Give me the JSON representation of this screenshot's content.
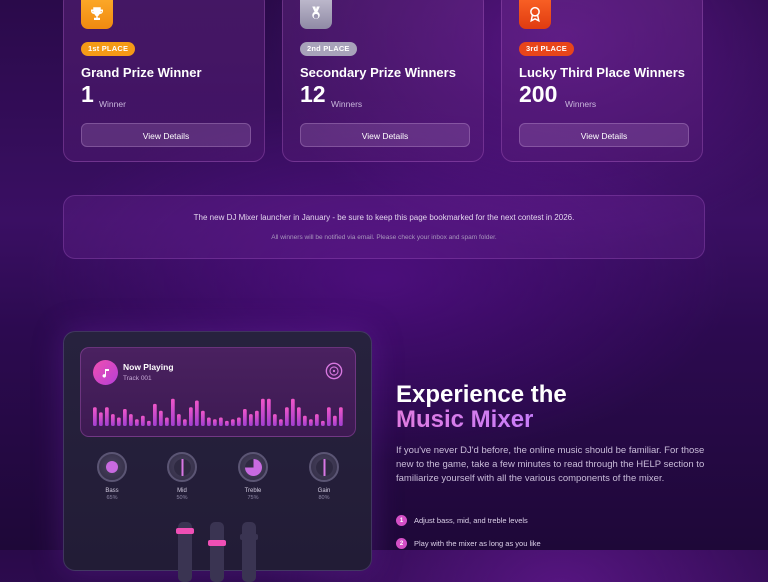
{
  "prize_cards": [
    {
      "badge": "1st PLACE",
      "title": "Grand Prize Winner",
      "count": "1",
      "unit": "Winner",
      "button": "View Details",
      "icon": "trophy-icon",
      "color": "#f59a16"
    },
    {
      "badge": "2nd PLACE",
      "title": "Secondary Prize Winners",
      "count": "12",
      "unit": "Winners",
      "button": "View Details",
      "icon": "medal-icon",
      "color": "#a8a3ba"
    },
    {
      "badge": "3rd PLACE",
      "title": "Lucky Third Place Winners",
      "count": "200",
      "unit": "Winners",
      "button": "View Details",
      "icon": "ribbon-award-icon",
      "color": "#e8451a"
    }
  ],
  "notice": {
    "main": "The new DJ Mixer launcher in January - be sure to keep this page bookmarked for the next contest in 2026.",
    "sub": "All winners will be notified via email. Please check your inbox and spam folder."
  },
  "mixer": {
    "now_playing_label": "Now Playing",
    "track": "Track 001",
    "eq_levels": [
      0.55,
      0.4,
      0.55,
      0.35,
      0.25,
      0.5,
      0.35,
      0.2,
      0.3,
      0.15,
      0.65,
      0.45,
      0.25,
      0.8,
      0.35,
      0.2,
      0.55,
      0.75,
      0.45,
      0.25,
      0.2,
      0.25,
      0.15,
      0.2,
      0.25,
      0.5,
      0.35,
      0.45,
      0.8,
      0.8,
      0.35,
      0.2,
      0.55,
      0.8,
      0.55,
      0.3,
      0.2,
      0.35,
      0.15,
      0.55,
      0.3,
      0.55
    ],
    "knobs": [
      {
        "label": "Bass",
        "value": "65%",
        "style": "bass"
      },
      {
        "label": "Mid",
        "value": "50%",
        "style": "half"
      },
      {
        "label": "Treble",
        "value": "75%",
        "style": "treble"
      },
      {
        "label": "Gain",
        "value": "80%",
        "style": "half"
      }
    ],
    "faders": [
      0.1,
      0.3,
      0.2
    ]
  },
  "experience": {
    "title_line1": "Experience the",
    "title_line2": "Music Mixer",
    "description": "If you've never DJ'd before, the online music should be familiar. For those new to the game, take a few minutes to read through the HELP section to familiarize yourself with all the various components of the mixer.",
    "bullets": [
      {
        "num": "1",
        "text": "Adjust bass, mid, and treble levels"
      },
      {
        "num": "2",
        "text": "Play with the mixer as long as you like"
      }
    ]
  }
}
